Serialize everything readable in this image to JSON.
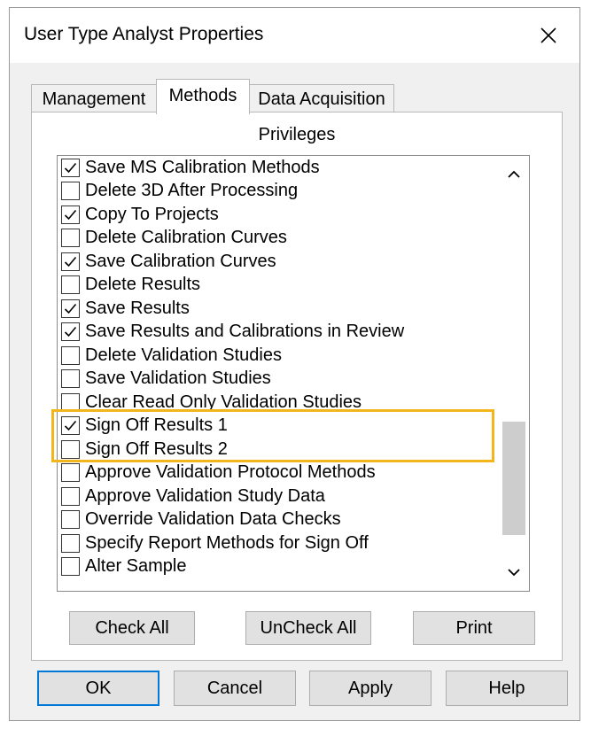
{
  "window": {
    "title": "User Type Analyst Properties",
    "close_icon": "close-icon"
  },
  "tabs": [
    {
      "label": "Management",
      "active": false
    },
    {
      "label": "Methods",
      "active": true
    },
    {
      "label": "Data Acquisition",
      "active": false
    }
  ],
  "privileges": {
    "group_label": "Privileges",
    "items": [
      {
        "label": "Save MS Calibration Methods",
        "checked": true
      },
      {
        "label": "Delete 3D After Processing",
        "checked": false
      },
      {
        "label": "Copy To Projects",
        "checked": true
      },
      {
        "label": "Delete Calibration Curves",
        "checked": false
      },
      {
        "label": "Save Calibration Curves",
        "checked": true
      },
      {
        "label": "Delete Results",
        "checked": false
      },
      {
        "label": "Save Results",
        "checked": true
      },
      {
        "label": "Save Results and Calibrations in Review",
        "checked": true
      },
      {
        "label": "Delete Validation Studies",
        "checked": false
      },
      {
        "label": "Save Validation Studies",
        "checked": false
      },
      {
        "label": "Clear Read Only Validation Studies",
        "checked": false
      },
      {
        "label": "Sign Off Results 1",
        "checked": true
      },
      {
        "label": "Sign Off Results 2",
        "checked": false
      },
      {
        "label": "Approve Validation Protocol Methods",
        "checked": false
      },
      {
        "label": "Approve Validation Study Data",
        "checked": false
      },
      {
        "label": "Override Validation Data Checks",
        "checked": false
      },
      {
        "label": "Specify Report Methods for Sign Off",
        "checked": false
      },
      {
        "label": "Alter Sample",
        "checked": false
      }
    ],
    "highlight_color": "#f2b51c"
  },
  "panel_buttons": {
    "check_all": "Check All",
    "uncheck_all": "UnCheck All",
    "print": "Print"
  },
  "dialog_buttons": {
    "ok": "OK",
    "cancel": "Cancel",
    "apply": "Apply",
    "help": "Help"
  },
  "colors": {
    "accent": "#0078d7",
    "dialog_bg": "#f0f0f0",
    "button_bg": "#e1e1e1"
  }
}
